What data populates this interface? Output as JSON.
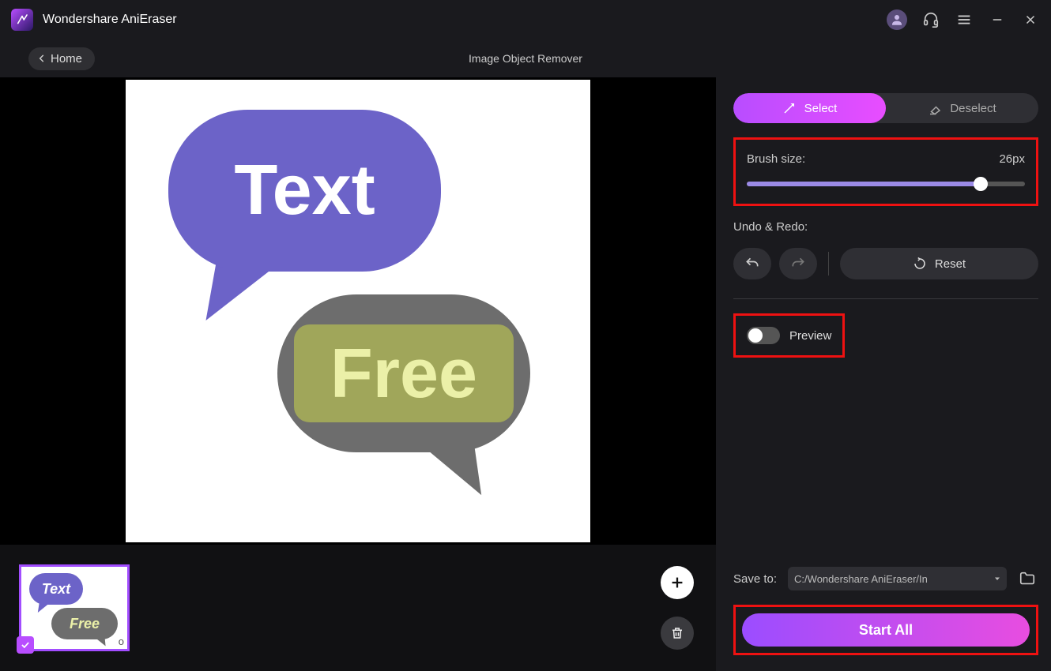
{
  "app": {
    "title": "Wondershare AniEraser"
  },
  "nav": {
    "home_label": "Home",
    "page_title": "Image Object Remover"
  },
  "canvas": {
    "bubble1_text": "Text",
    "bubble2_text": "Free"
  },
  "panel": {
    "select_label": "Select",
    "deselect_label": "Deselect",
    "brush_label": "Brush size:",
    "brush_value": "26px",
    "undo_label": "Undo & Redo:",
    "reset_label": "Reset",
    "preview_label": "Preview"
  },
  "bottom": {
    "thumb_text1": "Text",
    "thumb_text2": "Free",
    "thumb_filename_tail": "o",
    "save_label": "Save to:",
    "save_path": "C:/Wondershare AniEraser/In",
    "start_label": "Start All"
  }
}
